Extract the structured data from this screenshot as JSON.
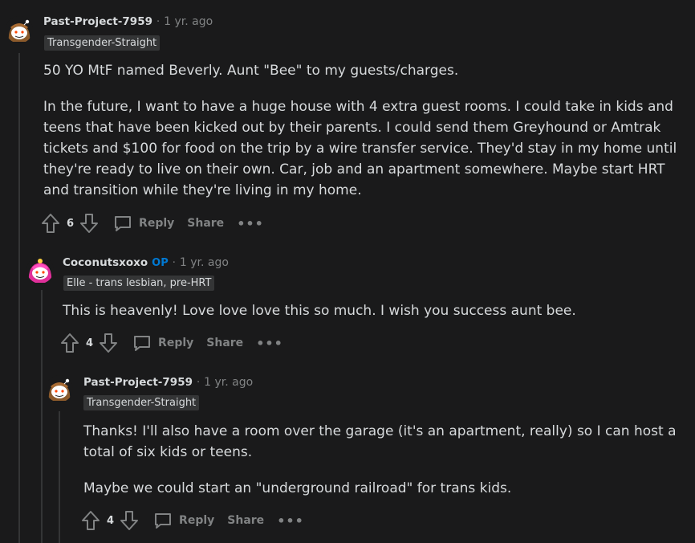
{
  "comments": [
    {
      "author": "Past-Project-7959",
      "op_badge": "",
      "separator": "·",
      "time": "1 yr. ago",
      "flair": "Transgender-Straight",
      "paragraphs": [
        "50 YO MtF named Beverly. Aunt \"Bee\" to my guests/charges.",
        "In the future, I want to have a huge house with 4 extra guest rooms. I could take in kids and teens that have been kicked out by their parents. I could send them Greyhound or Amtrak tickets and $100 for food on the trip by a wire transfer service. They'd stay in my home until they're ready to live on their own. Car, job and an apartment somewhere. Maybe start HRT and transition while they're living in my home."
      ],
      "votes": "6",
      "reply_label": "Reply",
      "share_label": "Share",
      "more_label": "•••"
    },
    {
      "author": "Coconutsxoxo",
      "op_badge": "OP",
      "separator": "·",
      "time": "1 yr. ago",
      "flair": "Elle - trans lesbian, pre-HRT",
      "paragraphs": [
        "This is heavenly! Love love love this so much. I wish you success aunt bee."
      ],
      "votes": "4",
      "reply_label": "Reply",
      "share_label": "Share",
      "more_label": "•••"
    },
    {
      "author": "Past-Project-7959",
      "op_badge": "",
      "separator": "·",
      "time": "1 yr. ago",
      "flair": "Transgender-Straight",
      "paragraphs": [
        "Thanks! I'll also have a room over the garage (it's an apartment, really) so I can host a total of six kids or teens.",
        "Maybe we could start an \"underground railroad\" for trans kids."
      ],
      "votes": "4",
      "reply_label": "Reply",
      "share_label": "Share",
      "more_label": "•••"
    }
  ],
  "colors": {
    "background": "#1a1a1b",
    "text": "#d7dadc",
    "muted": "#818384",
    "op_blue": "#0079d3",
    "flair_bg": "#343536"
  }
}
